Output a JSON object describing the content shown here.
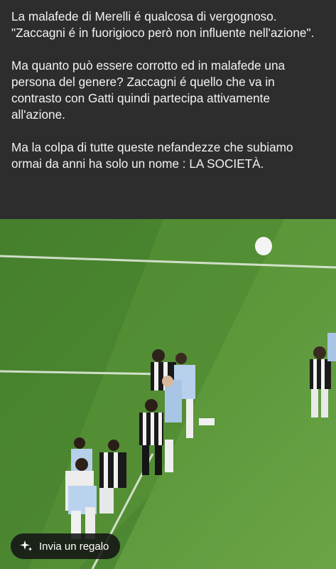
{
  "post": {
    "paragraphs": [
      "La malafede di Merelli é qualcosa di vergognoso.\n\"Zaccagni é in fuorigioco però non influente nell'azione\".",
      "Ma quanto può essere corrotto ed in malafede una persona del genere? Zaccagni é quello che va in contrasto con Gatti quindi partecipa attivamente all'azione.",
      "Ma la colpa di tutte queste nefandezze che subiamo ormai da anni ha solo un nome : LA SOCIETÀ."
    ]
  },
  "media": {
    "description_icon": "football-match-still-image",
    "pitch_colors": {
      "light": "#5e9a3c",
      "dark": "#3d7428"
    }
  },
  "actions": {
    "gift_label": "Invia un regalo",
    "gift_icon": "gift-sparkle-icon"
  }
}
